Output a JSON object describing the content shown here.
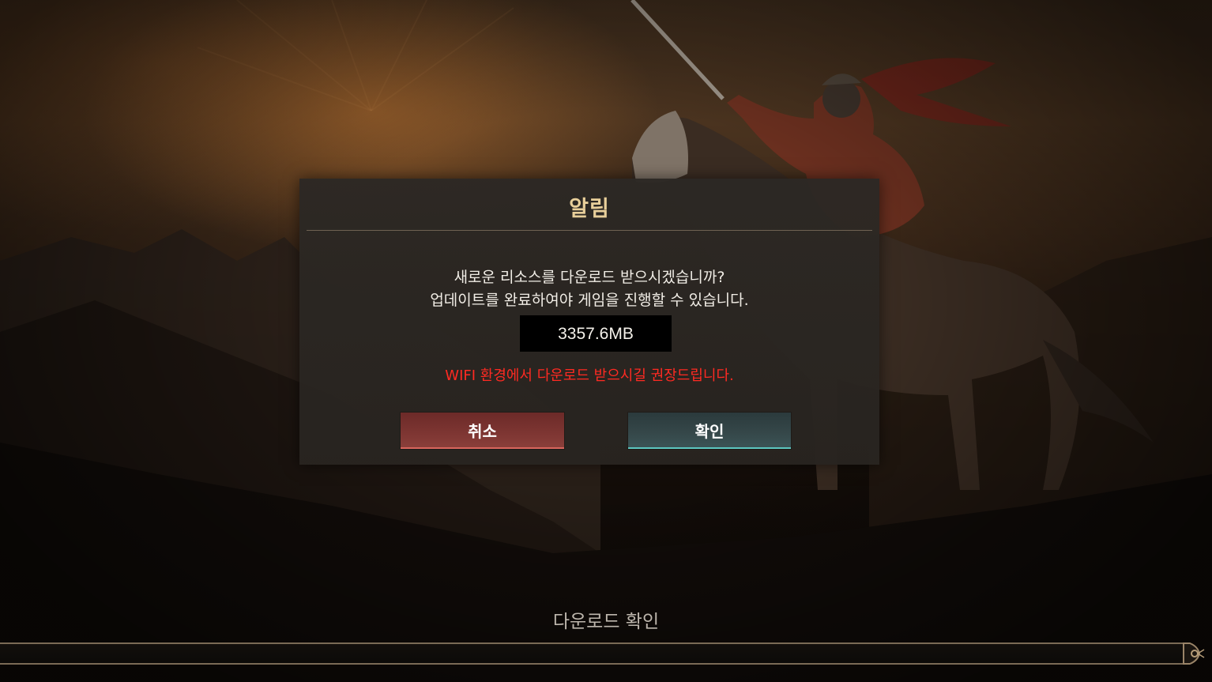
{
  "dialog": {
    "title": "알림",
    "message_line1": "새로운 리소스를 다운로드 받으시겠습니까?",
    "message_line2": "업데이트를 완료하여야 게임을 진행할 수 있습니다.",
    "download_size": "3357.6MB",
    "warning": "WIFI 환경에서 다운로드 받으시길 권장드립니다.",
    "cancel_label": "취소",
    "confirm_label": "확인"
  },
  "status": {
    "text": "다운로드 확인",
    "progress": 0
  },
  "colors": {
    "title": "#e8cf9a",
    "warning": "#ff2a22",
    "cancel_button": "#7d3532",
    "confirm_button": "#354749"
  },
  "icons": {
    "progress_end_cap": "ornament-icon"
  }
}
